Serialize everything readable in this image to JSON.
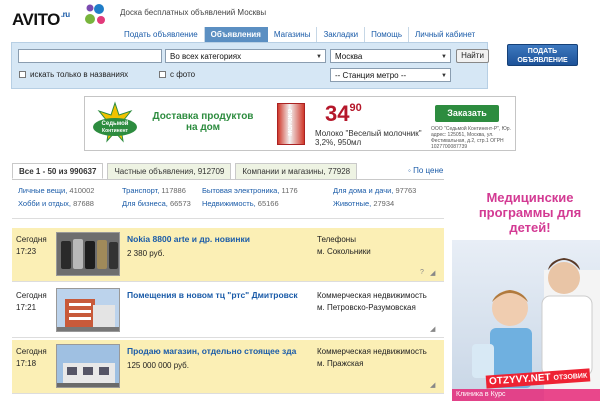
{
  "header": {
    "logo_text": "AVITO",
    "logo_suffix": ".ru",
    "site_description": "Доска бесплатных объявлений Москвы",
    "nav": [
      {
        "label": "Подать объявление",
        "active": false
      },
      {
        "label": "Объявления",
        "active": true
      },
      {
        "label": "Магазины",
        "active": false
      },
      {
        "label": "Закладки",
        "active": false
      },
      {
        "label": "Помощь",
        "active": false
      },
      {
        "label": "Личный кабинет",
        "active": false
      }
    ]
  },
  "search": {
    "query_value": "",
    "category_value": "Во всех категориях",
    "city_value": "Москва",
    "metro_value": "-- Станция метро --",
    "find_label": "Найти",
    "titles_only_label": "искать только в названиях",
    "with_photo_label": "с фото"
  },
  "post_button": {
    "line1": "Подать",
    "line2": "объявление"
  },
  "banner": {
    "logo_top": "Седьмой",
    "logo_bottom": "Континент",
    "title_line1": "Доставка продуктов",
    "title_line2": "на дом",
    "pack_label": "МОЛОКО",
    "price_main": "34",
    "price_cents": "90",
    "product_line1": "Молоко \"Веселый молочник\"",
    "product_line2": "3,2%, 950мл",
    "order_label": "Заказать",
    "legal_text": "ООО \"Седьмой Континент-Р\", Юр. адрес: 125051, Москва, ул. Фестивальная, д.2, стр.1 ОГРН 1027700087739"
  },
  "tabs": [
    {
      "label": "Все",
      "range": "1 - 50 из",
      "count": "990637",
      "active": true
    },
    {
      "label": "Частные объявления,",
      "count": "912709",
      "active": false
    },
    {
      "label": "Компании и магазины,",
      "count": "77928",
      "active": false
    }
  ],
  "sort_label": "По цене",
  "categories": [
    {
      "name": "Личные вещи,",
      "count": "410002"
    },
    {
      "name": "Транспорт,",
      "count": "117886"
    },
    {
      "name": "Бытовая электроника,",
      "count": "1176"
    },
    {
      "name": "Для дома и дачи,",
      "count": "97763"
    },
    {
      "name": "Хобби и отдых,",
      "count": "87688"
    },
    {
      "name": "Для бизнеса,",
      "count": "66573"
    },
    {
      "name": "Недвижимость,",
      "count": "65166"
    },
    {
      "name": "Животные,",
      "count": "27934"
    }
  ],
  "listings": [
    {
      "day": "Сегодня",
      "time": "17:23",
      "title": "Nokia 8800 arte и др. новинки",
      "price": "2 380 руб.",
      "category": "Телефоны",
      "location": "м. Сокольники",
      "highlighted": true
    },
    {
      "day": "Сегодня",
      "time": "17:21",
      "title": "Помещения в новом тц \"ртс\" Дмитровск",
      "price": "",
      "category": "Коммерческая недвижимость",
      "location": "м. Петровско-Разумовская",
      "highlighted": false
    },
    {
      "day": "Сегодня",
      "time": "17:18",
      "title": "Продаю магазин, отдельно стоящее зда",
      "price": "125 000 000 руб.",
      "category": "Коммерческая недвижимость",
      "location": "м. Пражская",
      "highlighted": true
    }
  ],
  "right_ad": {
    "title": "Медицинские программы для детей!",
    "footer": "Клиника в Курс",
    "watermark": "OTZYVY.NET",
    "watermark2": "ОТЗОВИК"
  },
  "colors": {
    "link": "#1a5ba8",
    "highlight_row": "#fbefb5",
    "search_bg": "#d6e7f5",
    "banner_green": "#2d8c3f",
    "price_red": "#b5172a",
    "ad_pink": "#d33a93"
  }
}
